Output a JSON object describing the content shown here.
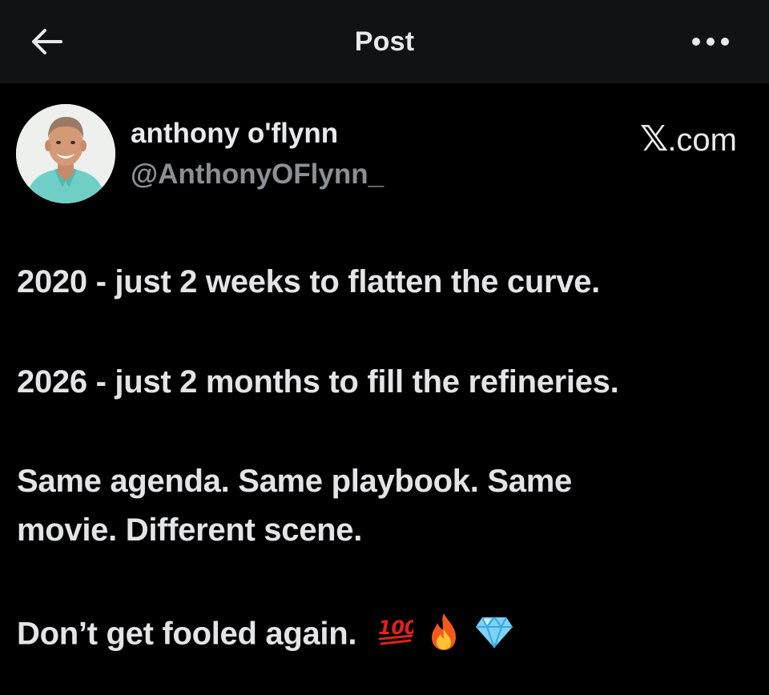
{
  "header": {
    "title": "Post",
    "back_icon": "arrow-left-icon",
    "more_icon": "more-horizontal-icon"
  },
  "author": {
    "display_name": "anthony o'flynn",
    "handle": "@AnthonyOFlynn_",
    "avatar": "profile-photo"
  },
  "source": {
    "label": ".com",
    "logo_letter": "𝕏"
  },
  "post": {
    "lines": [
      "2020 - just 2 weeks to flatten the curve.",
      "2026 - just 2 months to fill the refineries.",
      "Same agenda. Same playbook. Same",
      "movie. Different scene.",
      "Don’t get fooled again."
    ],
    "emojis": [
      "hundred-points-icon",
      "fire-icon",
      "gem-icon"
    ]
  },
  "colors": {
    "background": "#000000",
    "header_background": "#111214",
    "primary_text": "#e7e9ea",
    "secondary_text": "#8b9096",
    "fire": "#f25a1a",
    "gem": "#7cd3f7",
    "hundred": "#e0221b"
  }
}
